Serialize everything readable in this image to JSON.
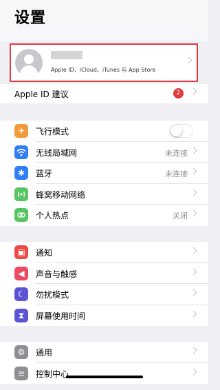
{
  "page_title": "设置",
  "profile": {
    "subtitle": "Apple ID、iCloud、iTunes 与 App Store"
  },
  "apple_id_suggestion": {
    "label": "Apple ID 建议",
    "badge": "2"
  },
  "colors": {
    "highlight_border": "#e0393e",
    "badge": "#e0393e"
  },
  "group1": [
    {
      "label": "飞行模式",
      "value": "",
      "control": "toggle",
      "toggle_on": false,
      "icon": "airplane-icon",
      "color": "#f29a38"
    },
    {
      "label": "无线局域网",
      "value": "未连接",
      "control": "chevron",
      "icon": "wifi-icon",
      "color": "#2f7ff6"
    },
    {
      "label": "蓝牙",
      "value": "未连接",
      "control": "chevron",
      "icon": "bluetooth-icon",
      "color": "#2f7ff6"
    },
    {
      "label": "蜂窝移动网络",
      "value": "",
      "control": "chevron",
      "icon": "cellular-icon",
      "color": "#58c564"
    },
    {
      "label": "个人热点",
      "value": "关闭",
      "control": "chevron",
      "icon": "hotspot-icon",
      "color": "#58c564"
    }
  ],
  "group2": [
    {
      "label": "通知",
      "value": "",
      "control": "chevron",
      "icon": "notifications-icon",
      "color": "#ec4a42"
    },
    {
      "label": "声音与触感",
      "value": "",
      "control": "chevron",
      "icon": "sounds-icon",
      "color": "#ec4a60"
    },
    {
      "label": "勿扰模式",
      "value": "",
      "control": "chevron",
      "icon": "moon-icon",
      "color": "#5b55d6"
    },
    {
      "label": "屏幕使用时间",
      "value": "",
      "control": "chevron",
      "icon": "hourglass-icon",
      "color": "#5b55d6"
    }
  ],
  "group3": [
    {
      "label": "通用",
      "value": "",
      "control": "chevron",
      "icon": "gear-icon",
      "color": "#8e8e93"
    },
    {
      "label": "控制中心",
      "value": "",
      "control": "chevron",
      "icon": "control-center-icon",
      "color": "#8e8e93"
    }
  ]
}
